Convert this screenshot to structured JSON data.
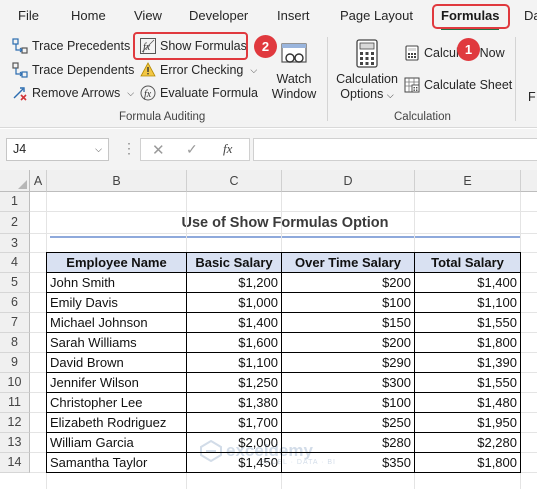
{
  "ribbon_tabs": {
    "file": "File",
    "home": "Home",
    "view": "View",
    "developer": "Developer",
    "insert": "Insert",
    "page_layout": "Page Layout",
    "formulas": "Formulas",
    "data_partial": "Da"
  },
  "formula_auditing": {
    "trace_precedents": "Trace Precedents",
    "trace_dependents": "Trace Dependents",
    "remove_arrows": "Remove Arrows",
    "show_formulas": "Show Formulas",
    "error_checking": "Error Checking",
    "evaluate_formula": "Evaluate Formula",
    "watch_window_line1": "Watch",
    "watch_window_line2": "Window",
    "group_label": "Formula Auditing"
  },
  "calculation": {
    "options_line1": "Calculation",
    "options_line2": "Options",
    "calculate_now": "Calculate Now",
    "calculate_sheet": "Calculate Sheet",
    "group_label": "Calculation"
  },
  "badges": {
    "one": "1",
    "two": "2"
  },
  "formula_bar": {
    "name_box": "J4",
    "fx_label": "fx",
    "formula_value": ""
  },
  "columns": [
    "A",
    "B",
    "C",
    "D",
    "E"
  ],
  "rows": [
    "1",
    "2",
    "3",
    "4",
    "5",
    "6",
    "7",
    "8",
    "9",
    "10",
    "11",
    "12",
    "13",
    "14"
  ],
  "sheet": {
    "title": "Use of Show Formulas Option",
    "headers": [
      "Employee Name",
      "Basic Salary",
      "Over Time Salary",
      "Total Salary"
    ],
    "data": [
      [
        "John Smith",
        "$1,200",
        "$200",
        "$1,400"
      ],
      [
        "Emily Davis",
        "$1,000",
        "$100",
        "$1,100"
      ],
      [
        "Michael Johnson",
        "$1,400",
        "$150",
        "$1,550"
      ],
      [
        "Sarah Williams",
        "$1,600",
        "$200",
        "$1,800"
      ],
      [
        "David Brown",
        "$1,100",
        "$290",
        "$1,390"
      ],
      [
        "Jennifer Wilson",
        "$1,250",
        "$300",
        "$1,550"
      ],
      [
        "Christopher Lee",
        "$1,380",
        "$100",
        "$1,480"
      ],
      [
        "Elizabeth Rodriguez",
        "$1,700",
        "$250",
        "$1,950"
      ],
      [
        "William Garcia",
        "$2,000",
        "$280",
        "$2,280"
      ],
      [
        "Samantha Taylor",
        "$1,450",
        "$350",
        "$1,800"
      ]
    ]
  },
  "watermark": {
    "brand": "exceldemy",
    "tagline": "EXCEL · DATA · BI"
  },
  "colors": {
    "accent_green": "#217346",
    "highlight_red": "#e0393e",
    "header_fill": "#d9e1f2",
    "title_underline": "#8ea9db"
  }
}
